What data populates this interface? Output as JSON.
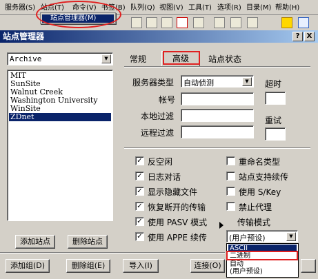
{
  "menu": [
    "服务器(S)",
    "站点(T)",
    "命令(V)",
    "书签(B)",
    "队列(Q)",
    "视图(V)",
    "工具(T)",
    "选项(R)",
    "目录(M)",
    "帮助(H)"
  ],
  "menu_dropdown_item": "站点管理器(M)",
  "dialog": {
    "title": "站点管理器",
    "help_btn": "?",
    "close_btn": "X"
  },
  "site_group": "Archive",
  "sites": [
    "MIT",
    "SunSite",
    "Walnut Creek",
    "Washington University",
    "WinSite",
    "ZDnet"
  ],
  "buttons": {
    "add_site": "添加站点",
    "delete_site": "删除站点",
    "add_group": "添加组(D)",
    "delete_group": "删除组(E)",
    "import": "导入(I)",
    "connect": "连接(O)"
  },
  "tabs": [
    "常规",
    "高级",
    "站点状态"
  ],
  "fields": {
    "server_type_label": "服务器类型",
    "server_type_value": "自动侦测",
    "timeout_label": "超时",
    "account_label": "帐号",
    "local_filter_label": "本地过滤",
    "remote_filter_label": "远程过滤",
    "retry_label": "重试"
  },
  "checkboxes": [
    {
      "label": "反空闲",
      "checked": true
    },
    {
      "label": "日志对话",
      "checked": true
    },
    {
      "label": "显示隐藏文件",
      "checked": true
    },
    {
      "label": "恢复断开的传输",
      "checked": true
    },
    {
      "label": "使用 PASV 模式",
      "checked": true
    },
    {
      "label": "使用 APPE 续传",
      "checked": true
    },
    {
      "label": "重命名类型",
      "checked": false
    },
    {
      "label": "站点支持续传",
      "checked": false
    },
    {
      "label": "使用 S/Key",
      "checked": false
    },
    {
      "label": "禁止代理",
      "checked": false
    }
  ],
  "transfer_mode_label": "传输模式",
  "transfer_mode_value": "(用户预设)",
  "transfer_mode_options": [
    "ASCII",
    "二进制",
    "自动",
    "(用户预设)"
  ],
  "colors": {
    "titlebar": "#0a246a",
    "highlight": "#0a246a",
    "annotation": "#e02020"
  }
}
